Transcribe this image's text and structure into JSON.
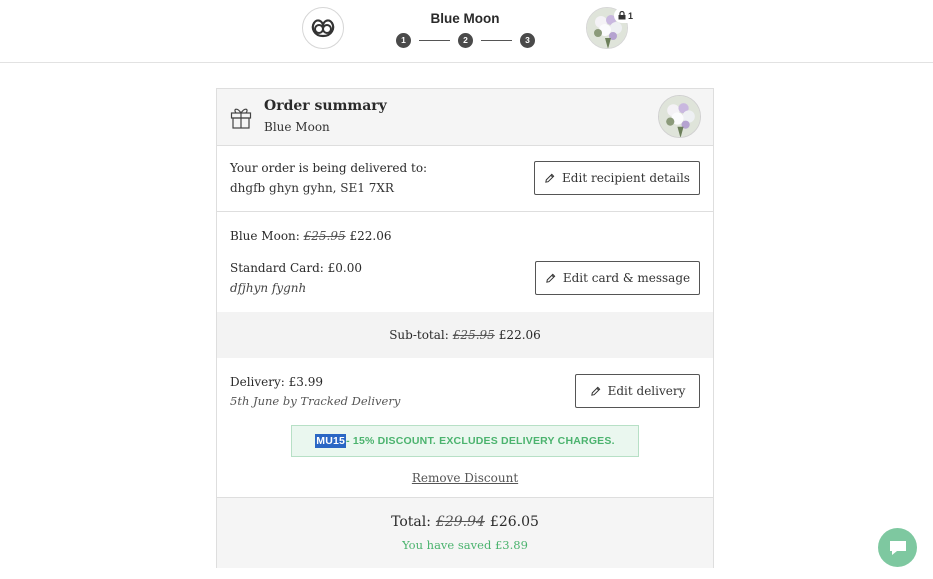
{
  "header": {
    "title": "Blue Moon",
    "steps": [
      "1",
      "2",
      "3"
    ],
    "basket_count": "1"
  },
  "summary": {
    "title": "Order summary",
    "product": "Blue Moon"
  },
  "recipient": {
    "label": "Your order is being delivered to:",
    "address": "dhgfb ghyn gyhn, SE1 7XR",
    "edit_button": "Edit recipient details"
  },
  "items": {
    "product_label": "Blue Moon:",
    "product_old_price": "£25.95",
    "product_price": "£22.06",
    "card_label": "Standard Card: £0.00",
    "card_message": "dfjhyn fygnh",
    "edit_button": "Edit card & message"
  },
  "subtotal": {
    "label": "Sub-total:",
    "old_price": "£25.95",
    "price": "£22.06"
  },
  "delivery": {
    "label": "Delivery: £3.99",
    "detail": "5th June by Tracked Delivery",
    "edit_button": "Edit delivery",
    "discount_code": "MU15",
    "discount_text": " - 15% DISCOUNT. EXCLUDES DELIVERY CHARGES.",
    "remove_link": "Remove Discount"
  },
  "total": {
    "label": "Total:",
    "old_price": "£29.94",
    "price": "£26.05",
    "saved": "You have saved £3.89"
  },
  "colors": {
    "accent_green": "#4bb36e",
    "discount_bg": "#eaf7ef",
    "chat_bg": "#7ec8a0",
    "step_bg": "#4a4a4a"
  }
}
